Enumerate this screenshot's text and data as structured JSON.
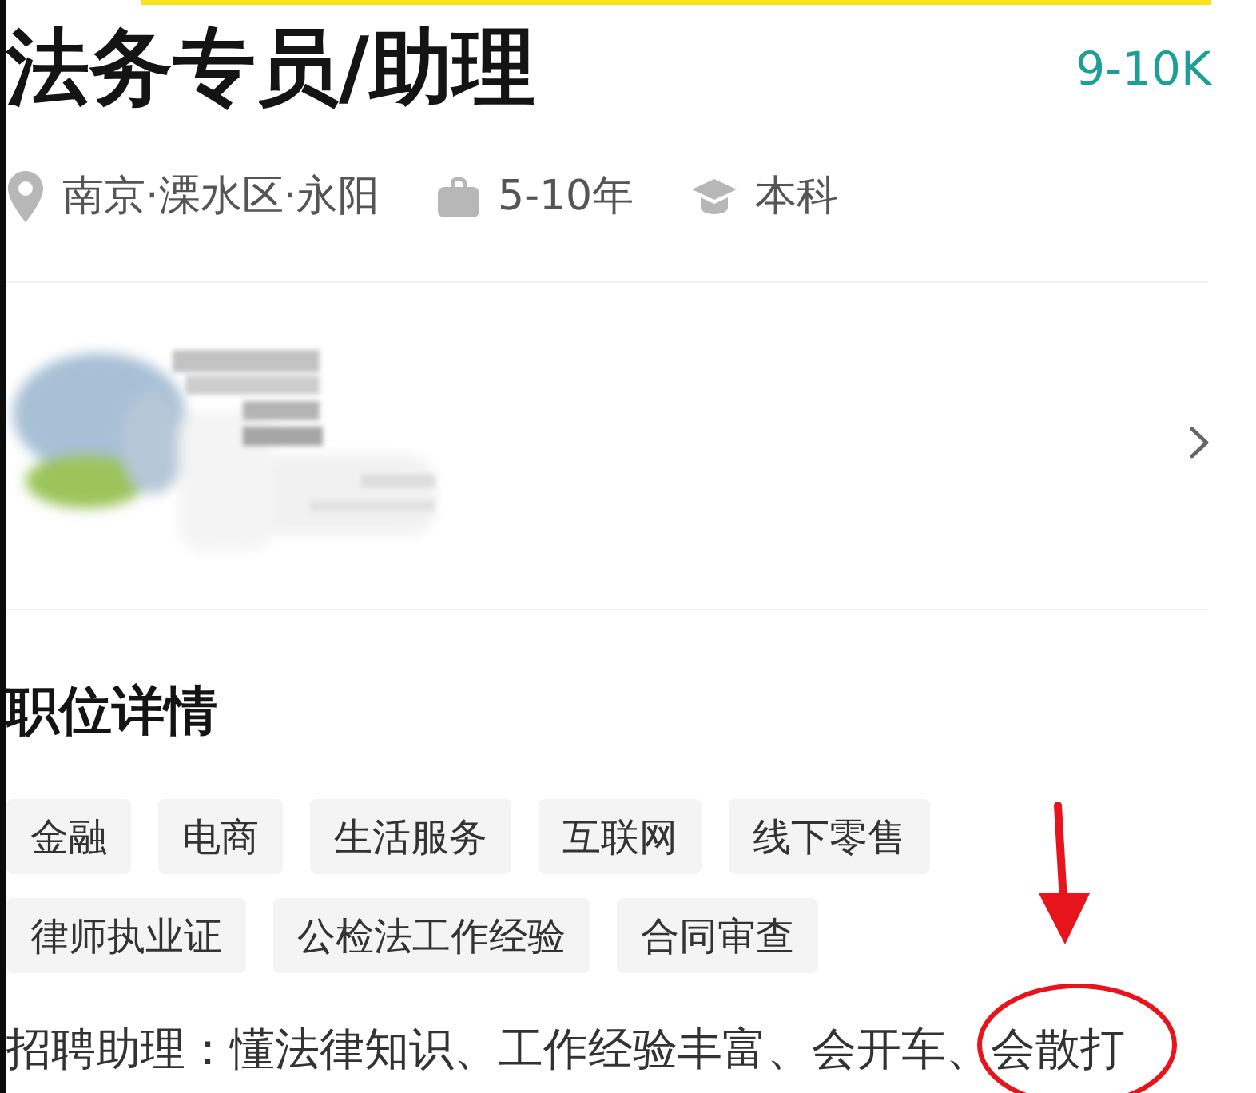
{
  "job": {
    "title": "法务专员/助理",
    "salary": "9-10K",
    "meta": [
      {
        "kind": "location",
        "text": "南京·溧水区·永阳"
      },
      {
        "kind": "experience",
        "text": "5-10年"
      },
      {
        "kind": "education",
        "text": "本科"
      }
    ]
  },
  "details": {
    "heading": "职位详情",
    "tags": [
      "金融",
      "电商",
      "生活服务",
      "互联网",
      "线下零售",
      "律师执业证",
      "公检法工作经验",
      "合同审查"
    ],
    "description": "招聘助理：懂法律知识、工作经验丰富、会开车、会散打"
  },
  "markup": {
    "arrow": true,
    "circle": true
  }
}
